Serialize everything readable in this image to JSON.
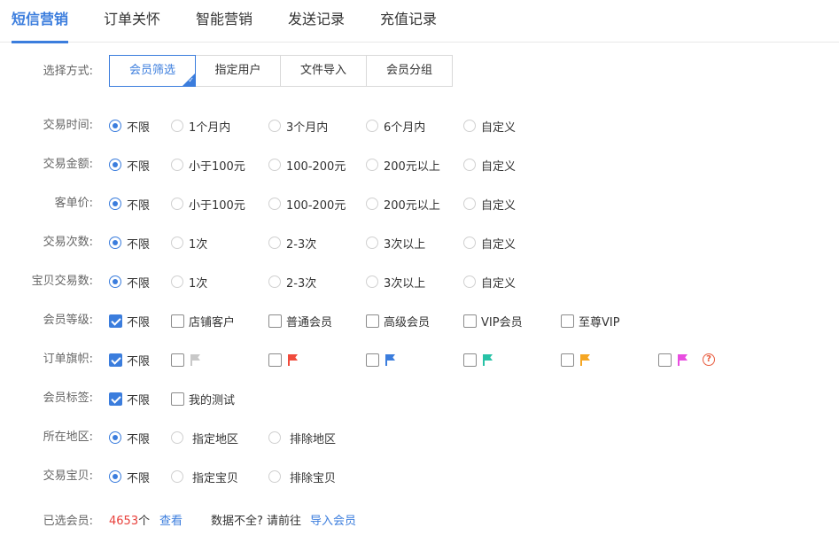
{
  "tabs": [
    "短信营销",
    "订单关怀",
    "智能营销",
    "发送记录",
    "充值记录"
  ],
  "method": {
    "label": "选择方式:",
    "options": [
      "会员筛选",
      "指定用户",
      "文件导入",
      "会员分组"
    ],
    "selected": "会员筛选"
  },
  "filters": {
    "trade_time": {
      "label": "交易时间:",
      "options": [
        "不限",
        "1个月内",
        "3个月内",
        "6个月内",
        "自定义"
      ]
    },
    "trade_amount": {
      "label": "交易金额:",
      "options": [
        "不限",
        "小于100元",
        "100-200元",
        "200元以上",
        "自定义"
      ]
    },
    "unit_price": {
      "label": "客单价:",
      "options": [
        "不限",
        "小于100元",
        "100-200元",
        "200元以上",
        "自定义"
      ]
    },
    "trade_count": {
      "label": "交易次数:",
      "options": [
        "不限",
        "1次",
        "2-3次",
        "3次以上",
        "自定义"
      ]
    },
    "item_trade_count": {
      "label": "宝贝交易数:",
      "options": [
        "不限",
        "1次",
        "2-3次",
        "3次以上",
        "自定义"
      ]
    },
    "member_level": {
      "label": "会员等级:",
      "options": [
        "不限",
        "店铺客户",
        "普通会员",
        "高级会员",
        "VIP会员",
        "至尊VIP"
      ]
    },
    "order_flag": {
      "label": "订单旗帜:",
      "all_label": "不限",
      "flag_colors": [
        "#c8c8c8",
        "#f04b3c",
        "#3b7ddd",
        "#27c2a6",
        "#f5a623",
        "#e84de0"
      ],
      "help_icon": "?"
    },
    "member_tag": {
      "label": "会员标签:",
      "options": [
        "不限",
        "我的测试"
      ]
    },
    "region": {
      "label": "所在地区:",
      "options": [
        "不限",
        "指定地区",
        "排除地区"
      ]
    },
    "trade_item": {
      "label": "交易宝贝:",
      "options": [
        "不限",
        "指定宝贝",
        "排除宝贝"
      ]
    }
  },
  "footer": {
    "label": "已选会员:",
    "count": "4653",
    "unit": "个",
    "view_link": "查看",
    "incomplete_text": "数据不全? 请前往",
    "import_link": "导入会员"
  }
}
